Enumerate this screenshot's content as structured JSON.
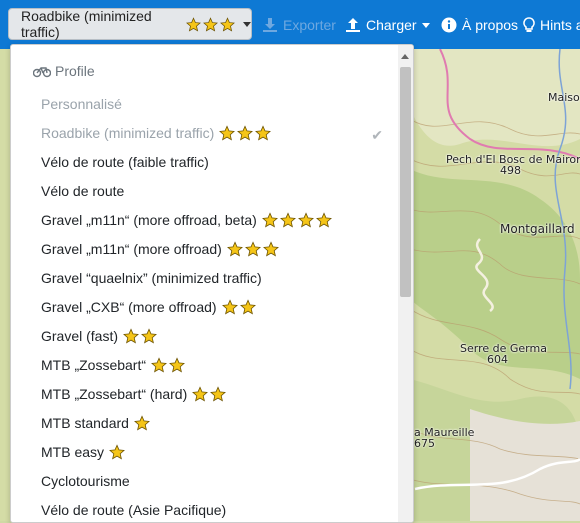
{
  "navbar": {
    "profile_button": "Roadbike (minimized traffic)",
    "exporter": "Exporter",
    "charger": "Charger",
    "a_propos": "À propos",
    "hints": "Hints ar"
  },
  "dropdown": {
    "header": "Profile",
    "items": [
      {
        "label": "Personnalisé",
        "stars": 0,
        "muted": true
      },
      {
        "label": "Roadbike (minimized traffic)",
        "stars": 3,
        "muted": true,
        "selected": true
      },
      {
        "label": "Vélo de route (faible traffic)",
        "stars": 0
      },
      {
        "label": "Vélo de route",
        "stars": 0
      },
      {
        "label": "Gravel „m11n“ (more offroad, beta)",
        "stars": 4
      },
      {
        "label": "Gravel „m11n“ (more offroad)",
        "stars": 3
      },
      {
        "label": "Gravel “quaelnix” (minimized traffic)",
        "stars": 0
      },
      {
        "label": "Gravel „CXB“ (more offroad)",
        "stars": 2
      },
      {
        "label": "Gravel (fast)",
        "stars": 2
      },
      {
        "label": "MTB „Zossebart“",
        "stars": 2
      },
      {
        "label": "MTB „Zossebart“ (hard)",
        "stars": 2
      },
      {
        "label": "MTB standard",
        "stars": 1
      },
      {
        "label": "MTB easy",
        "stars": 1
      },
      {
        "label": "Cyclotourisme",
        "stars": 0
      },
      {
        "label": "Vélo de route (Asie Pacifique)",
        "stars": 0
      }
    ]
  },
  "map": {
    "labels": [
      "Maiso",
      "Pech d'El Bosc de Maironnes",
      "498",
      "Montgaillard",
      "Serre de Germa",
      "604",
      "a Maureille",
      "675"
    ]
  },
  "colors": {
    "navbar": "#0e79d4",
    "star": "#f5c518"
  }
}
